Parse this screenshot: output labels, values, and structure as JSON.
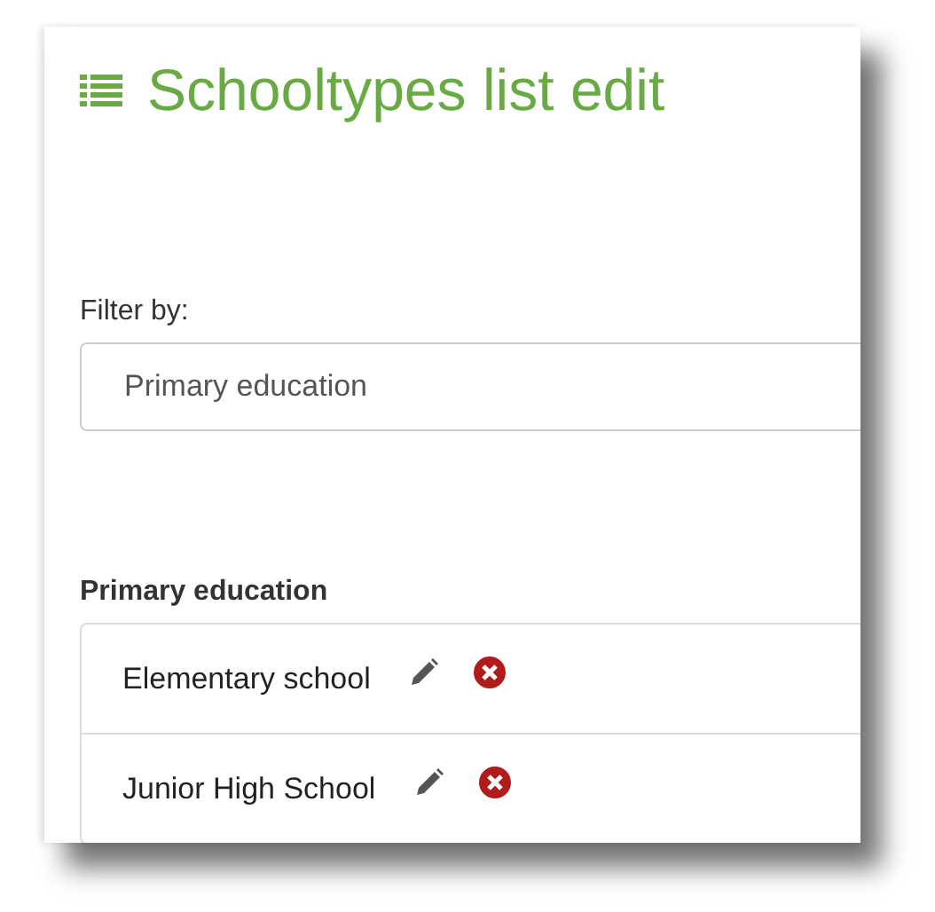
{
  "title": "Schooltypes list edit",
  "filter": {
    "label": "Filter by:",
    "value": "Primary education"
  },
  "group": {
    "heading": "Primary education",
    "items": [
      {
        "name": "Elementary school"
      },
      {
        "name": "Junior High School"
      }
    ]
  }
}
